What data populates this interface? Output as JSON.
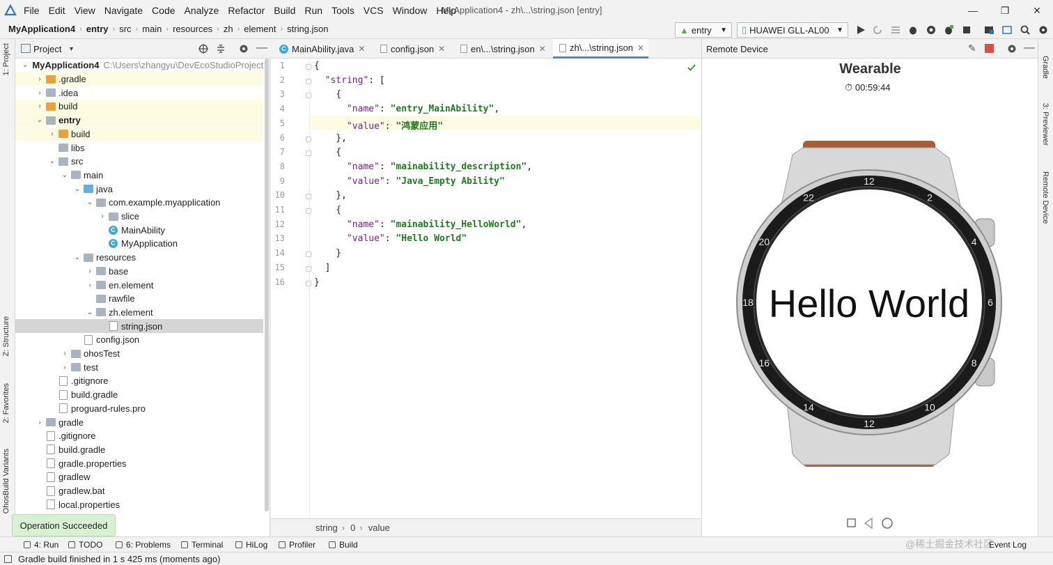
{
  "menu": {
    "items": [
      "File",
      "Edit",
      "View",
      "Navigate",
      "Code",
      "Analyze",
      "Refactor",
      "Build",
      "Run",
      "Tools",
      "VCS",
      "Window",
      "Help"
    ],
    "window_title": "MyApplication4 - zh\\...\\string.json [entry]"
  },
  "breadcrumb": {
    "items": [
      "MyApplication4",
      "entry",
      "src",
      "main",
      "resources",
      "zh",
      "element",
      "string.json"
    ]
  },
  "toolbar": {
    "module_select": "entry",
    "device_select": "HUAWEI GLL-AL00"
  },
  "left_stripe": {
    "project": "1: Project",
    "structure": "Z: Structure",
    "favorites": "2: Favorites",
    "build_variants": "OhosBuild Variants"
  },
  "right_stripe": {
    "gradle": "Gradle",
    "previewer": "3: Previewer",
    "remote": "Remote Device"
  },
  "project_panel": {
    "title": "Project",
    "tree": [
      {
        "label": "MyApplication4",
        "path": "C:\\Users\\zhangyu\\DevEcoStudioProject",
        "depth": 0,
        "arrow": "down",
        "icon": "folder",
        "bold": true
      },
      {
        "label": ".gradle",
        "depth": 1,
        "arrow": "right",
        "icon": "folder-orange",
        "hl": true
      },
      {
        "label": ".idea",
        "depth": 1,
        "arrow": "right",
        "icon": "folder"
      },
      {
        "label": "build",
        "depth": 1,
        "arrow": "right",
        "icon": "folder-orange",
        "hl": true
      },
      {
        "label": "entry",
        "depth": 1,
        "arrow": "down",
        "icon": "folder",
        "bold": true,
        "hl": true
      },
      {
        "label": "build",
        "depth": 2,
        "arrow": "right",
        "icon": "folder-orange",
        "hl": true
      },
      {
        "label": "libs",
        "depth": 2,
        "arrow": "",
        "icon": "folder"
      },
      {
        "label": "src",
        "depth": 2,
        "arrow": "down",
        "icon": "folder"
      },
      {
        "label": "main",
        "depth": 3,
        "arrow": "down",
        "icon": "folder"
      },
      {
        "label": "java",
        "depth": 4,
        "arrow": "down",
        "icon": "folder-blue"
      },
      {
        "label": "com.example.myapplication",
        "depth": 5,
        "arrow": "down",
        "icon": "folder"
      },
      {
        "label": "slice",
        "depth": 6,
        "arrow": "right",
        "icon": "folder"
      },
      {
        "label": "MainAbility",
        "depth": 6,
        "arrow": "",
        "icon": "class"
      },
      {
        "label": "MyApplication",
        "depth": 6,
        "arrow": "",
        "icon": "class"
      },
      {
        "label": "resources",
        "depth": 4,
        "arrow": "down",
        "icon": "folder"
      },
      {
        "label": "base",
        "depth": 5,
        "arrow": "right",
        "icon": "folder"
      },
      {
        "label": "en.element",
        "depth": 5,
        "arrow": "right",
        "icon": "folder"
      },
      {
        "label": "rawfile",
        "depth": 5,
        "arrow": "",
        "icon": "folder"
      },
      {
        "label": "zh.element",
        "depth": 5,
        "arrow": "down",
        "icon": "folder"
      },
      {
        "label": "string.json",
        "depth": 6,
        "arrow": "",
        "icon": "file",
        "sel": true
      },
      {
        "label": "config.json",
        "depth": 4,
        "arrow": "",
        "icon": "file"
      },
      {
        "label": "ohosTest",
        "depth": 3,
        "arrow": "right",
        "icon": "folder"
      },
      {
        "label": "test",
        "depth": 3,
        "arrow": "right",
        "icon": "folder"
      },
      {
        "label": ".gitignore",
        "depth": 2,
        "arrow": "",
        "icon": "file"
      },
      {
        "label": "build.gradle",
        "depth": 2,
        "arrow": "",
        "icon": "file"
      },
      {
        "label": "proguard-rules.pro",
        "depth": 2,
        "arrow": "",
        "icon": "file"
      },
      {
        "label": "gradle",
        "depth": 1,
        "arrow": "right",
        "icon": "folder"
      },
      {
        "label": ".gitignore",
        "depth": 1,
        "arrow": "",
        "icon": "file"
      },
      {
        "label": "build.gradle",
        "depth": 1,
        "arrow": "",
        "icon": "file"
      },
      {
        "label": "gradle.properties",
        "depth": 1,
        "arrow": "",
        "icon": "file"
      },
      {
        "label": "gradlew",
        "depth": 1,
        "arrow": "",
        "icon": "file"
      },
      {
        "label": "gradlew.bat",
        "depth": 1,
        "arrow": "",
        "icon": "file"
      },
      {
        "label": "local.properties",
        "depth": 1,
        "arrow": "",
        "icon": "file"
      }
    ]
  },
  "editor": {
    "tabs": [
      {
        "label": "MainAbility.java",
        "icon": "class"
      },
      {
        "label": "config.json",
        "icon": "file"
      },
      {
        "label": "en\\...\\string.json",
        "icon": "file"
      },
      {
        "label": "zh\\...\\string.json",
        "icon": "file",
        "active": true
      }
    ],
    "lines": [
      [
        [
          "p",
          "{"
        ]
      ],
      [
        [
          "p",
          "  "
        ],
        [
          "k",
          "\"string\""
        ],
        [
          "p",
          ": ["
        ]
      ],
      [
        [
          "p",
          "    {"
        ]
      ],
      [
        [
          "p",
          "      "
        ],
        [
          "k",
          "\"name\""
        ],
        [
          "p",
          ": "
        ],
        [
          "s",
          "\"entry_MainAbility\""
        ],
        [
          "p",
          ","
        ]
      ],
      [
        [
          "p",
          "      "
        ],
        [
          "k",
          "\"value\""
        ],
        [
          "p",
          ": "
        ],
        [
          "s",
          "\"鸿蒙应用\""
        ]
      ],
      [
        [
          "p",
          "    },"
        ]
      ],
      [
        [
          "p",
          "    {"
        ]
      ],
      [
        [
          "p",
          "      "
        ],
        [
          "k",
          "\"name\""
        ],
        [
          "p",
          ": "
        ],
        [
          "s",
          "\"mainability_description\""
        ],
        [
          "p",
          ","
        ]
      ],
      [
        [
          "p",
          "      "
        ],
        [
          "k",
          "\"value\""
        ],
        [
          "p",
          ": "
        ],
        [
          "s",
          "\"Java_Empty Ability\""
        ]
      ],
      [
        [
          "p",
          "    },"
        ]
      ],
      [
        [
          "p",
          "    {"
        ]
      ],
      [
        [
          "p",
          "      "
        ],
        [
          "k",
          "\"name\""
        ],
        [
          "p",
          ": "
        ],
        [
          "s",
          "\"mainability_HelloWorld\""
        ],
        [
          "p",
          ","
        ]
      ],
      [
        [
          "p",
          "      "
        ],
        [
          "k",
          "\"value\""
        ],
        [
          "p",
          ": "
        ],
        [
          "s",
          "\"Hello World\""
        ]
      ],
      [
        [
          "p",
          "    }"
        ]
      ],
      [
        [
          "p",
          "  ]"
        ]
      ],
      [
        [
          "p",
          "}"
        ]
      ]
    ],
    "footer_path": [
      "string",
      "0",
      "value"
    ]
  },
  "remote_device": {
    "title": "Remote Device",
    "device_name": "Wearable",
    "timer": "00:59:44",
    "screen_text": "Hello World",
    "bezel_numbers": [
      "12",
      "2",
      "4",
      "6",
      "8",
      "10",
      "12",
      "14",
      "16",
      "18",
      "20",
      "22"
    ]
  },
  "bottom_tools": [
    "4: Run",
    "TODO",
    "6: Problems",
    "Terminal",
    "HiLog",
    "Profiler",
    "Build"
  ],
  "event_log": "Event Log",
  "status_text": "Gradle build finished in 1 s 425 ms (moments ago)",
  "toast": "Operation Succeeded",
  "watermark": "@稀土掘金技术社区",
  "colors": {
    "accent": "#4a87c8",
    "string": "#1f7a1f",
    "key": "#7a1f84",
    "highlight": "#fdfbe1"
  }
}
